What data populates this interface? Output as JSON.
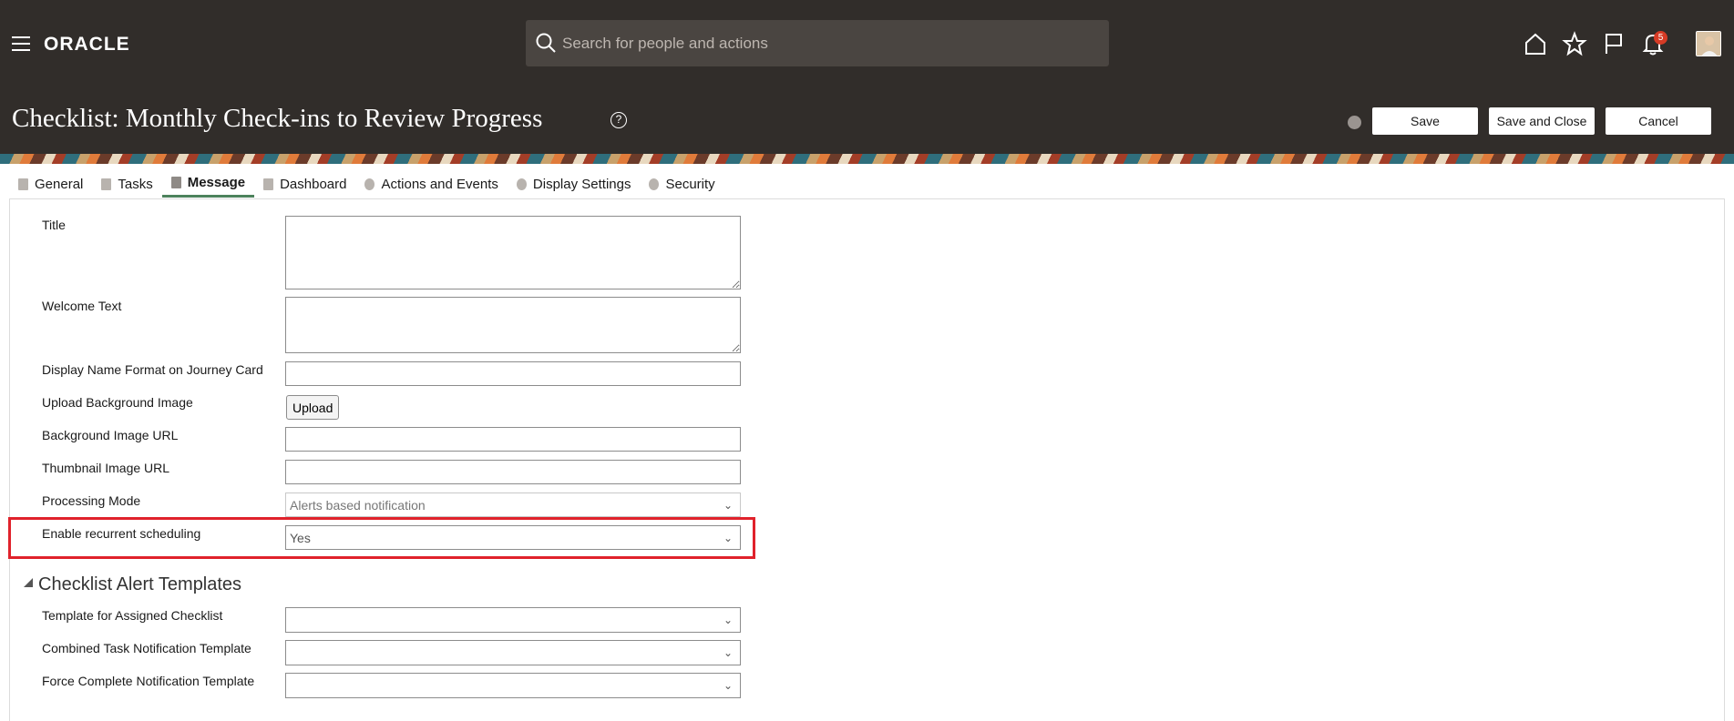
{
  "header": {
    "logo_text": "ORACLE",
    "search_placeholder": "Search for people and actions",
    "notification_count": "5",
    "icons": [
      "menu-icon",
      "home-icon",
      "favorites-icon",
      "flag-icon",
      "bell-icon"
    ]
  },
  "page": {
    "title": "Checklist: Monthly Check-ins to Review Progress",
    "help_icon": "?",
    "buttons": {
      "save": "Save",
      "save_close": "Save and Close",
      "cancel": "Cancel"
    }
  },
  "tabs": [
    {
      "label": "General"
    },
    {
      "label": "Tasks"
    },
    {
      "label": "Message",
      "active": true
    },
    {
      "label": "Dashboard"
    },
    {
      "label": "Actions and Events"
    },
    {
      "label": "Display Settings"
    },
    {
      "label": "Security"
    }
  ],
  "form": {
    "title_label": "Title",
    "welcome_label": "Welcome Text",
    "display_name_label": "Display Name Format on Journey Card",
    "upload_bg_label": "Upload Background Image",
    "upload_button": "Upload",
    "bg_url_label": "Background Image URL",
    "thumb_url_label": "Thumbnail Image URL",
    "processing_mode_label": "Processing Mode",
    "processing_mode_value": "Alerts based notification",
    "recurrent_label": "Enable recurrent scheduling",
    "recurrent_value": "Yes"
  },
  "alerts_section": {
    "heading": "Checklist Alert Templates",
    "assigned_label": "Template for Assigned Checklist",
    "combined_label": "Combined Task Notification Template",
    "force_label": "Force Complete Notification Template"
  },
  "colors": {
    "header_bg": "#312d2a",
    "active_tab": "#4c825c",
    "highlight": "#e0222b",
    "badge": "#d63b25"
  }
}
